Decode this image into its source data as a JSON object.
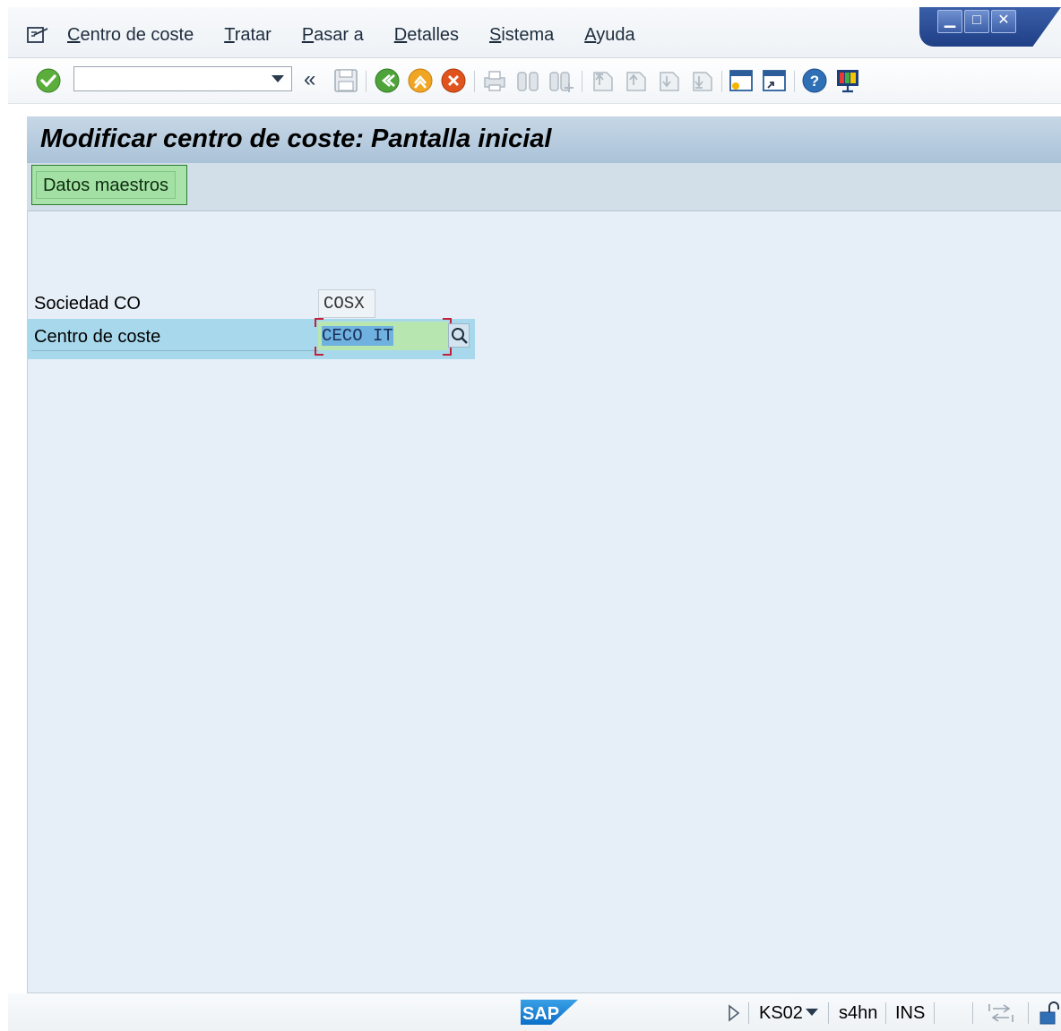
{
  "menu": {
    "items": [
      {
        "u": "C",
        "rest": "entro de coste"
      },
      {
        "u": "T",
        "rest": "ratar"
      },
      {
        "u": "P",
        "rest": "asar a"
      },
      {
        "u": "D",
        "rest": "etalles"
      },
      {
        "u": "S",
        "rest": "istema"
      },
      {
        "u": "A",
        "rest": "yuda"
      }
    ]
  },
  "toolbar": {
    "command_value": "",
    "back_label": "«"
  },
  "page": {
    "title": "Modificar centro de coste: Pantalla inicial",
    "master_data_button": "Datos maestros"
  },
  "form": {
    "company_label": "Sociedad CO",
    "company_value": "COSX",
    "costcenter_label": "Centro de coste",
    "costcenter_value": "CECO IT"
  },
  "status": {
    "transaction": "KS02",
    "system": "s4hn",
    "mode": "INS",
    "logo_text": "SAP"
  },
  "colors": {
    "accent_green": "#a9e3aa",
    "highlight_row": "#a8d8ec",
    "title_bar": "#aac2d8"
  }
}
